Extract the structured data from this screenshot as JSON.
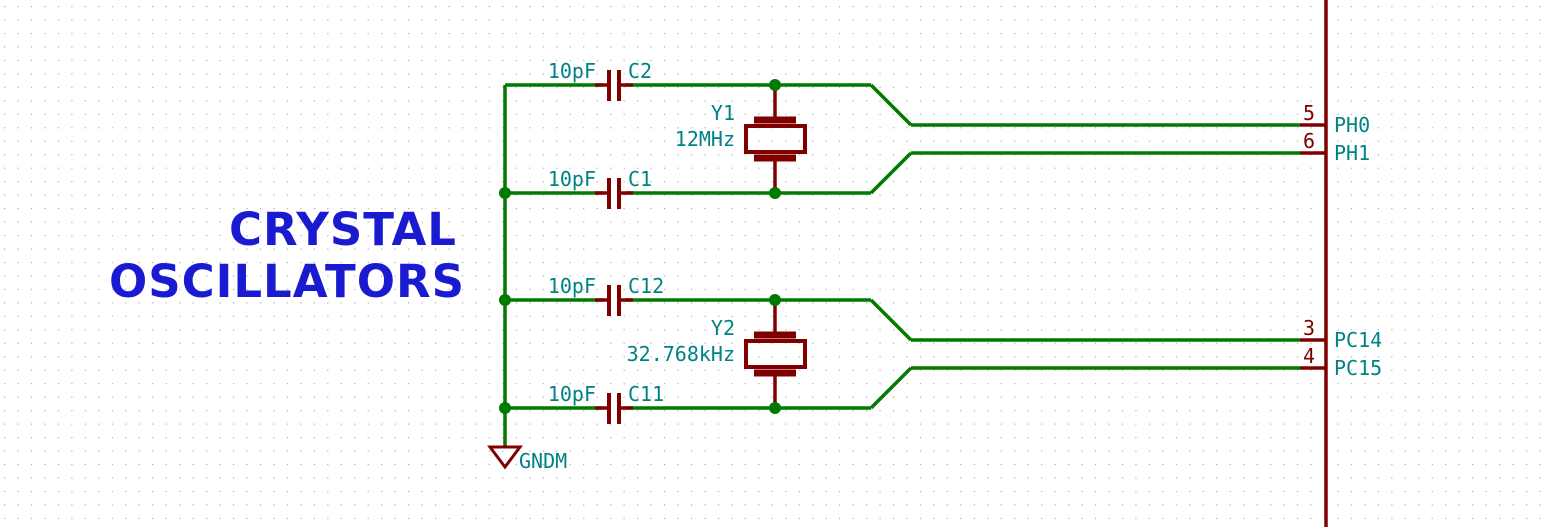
{
  "sheet": {
    "title_line1": "CRYSTAL",
    "title_line2": "OSCILLATORS",
    "title_color": "#1a1ad0",
    "background_color": "#ffffff",
    "grid_dot_color": "#a8a8a8"
  },
  "colors": {
    "wire_green": "#007a00",
    "symbol_red": "#800000",
    "label_teal": "#008284",
    "junction_green": "#007a00",
    "pin_number_red": "#800000"
  },
  "oscillators": [
    {
      "id": "osc-1",
      "crystal": {
        "reference": "Y1",
        "value": "12MHz"
      },
      "capacitors": [
        {
          "reference": "C2",
          "value": "10pF",
          "position": "top"
        },
        {
          "reference": "C1",
          "value": "10pF",
          "position": "bottom"
        }
      ],
      "pins": [
        {
          "number": "5",
          "name": "PH0"
        },
        {
          "number": "6",
          "name": "PH1"
        }
      ]
    },
    {
      "id": "osc-2",
      "crystal": {
        "reference": "Y2",
        "value": "32.768kHz"
      },
      "capacitors": [
        {
          "reference": "C12",
          "value": "10pF",
          "position": "top"
        },
        {
          "reference": "C11",
          "value": "10pF",
          "position": "bottom"
        }
      ],
      "pins": [
        {
          "number": "3",
          "name": "PC14"
        },
        {
          "number": "4",
          "name": "PC15"
        }
      ]
    }
  ],
  "power_symbols": [
    {
      "name": "GNDM",
      "type": "ground"
    }
  ]
}
